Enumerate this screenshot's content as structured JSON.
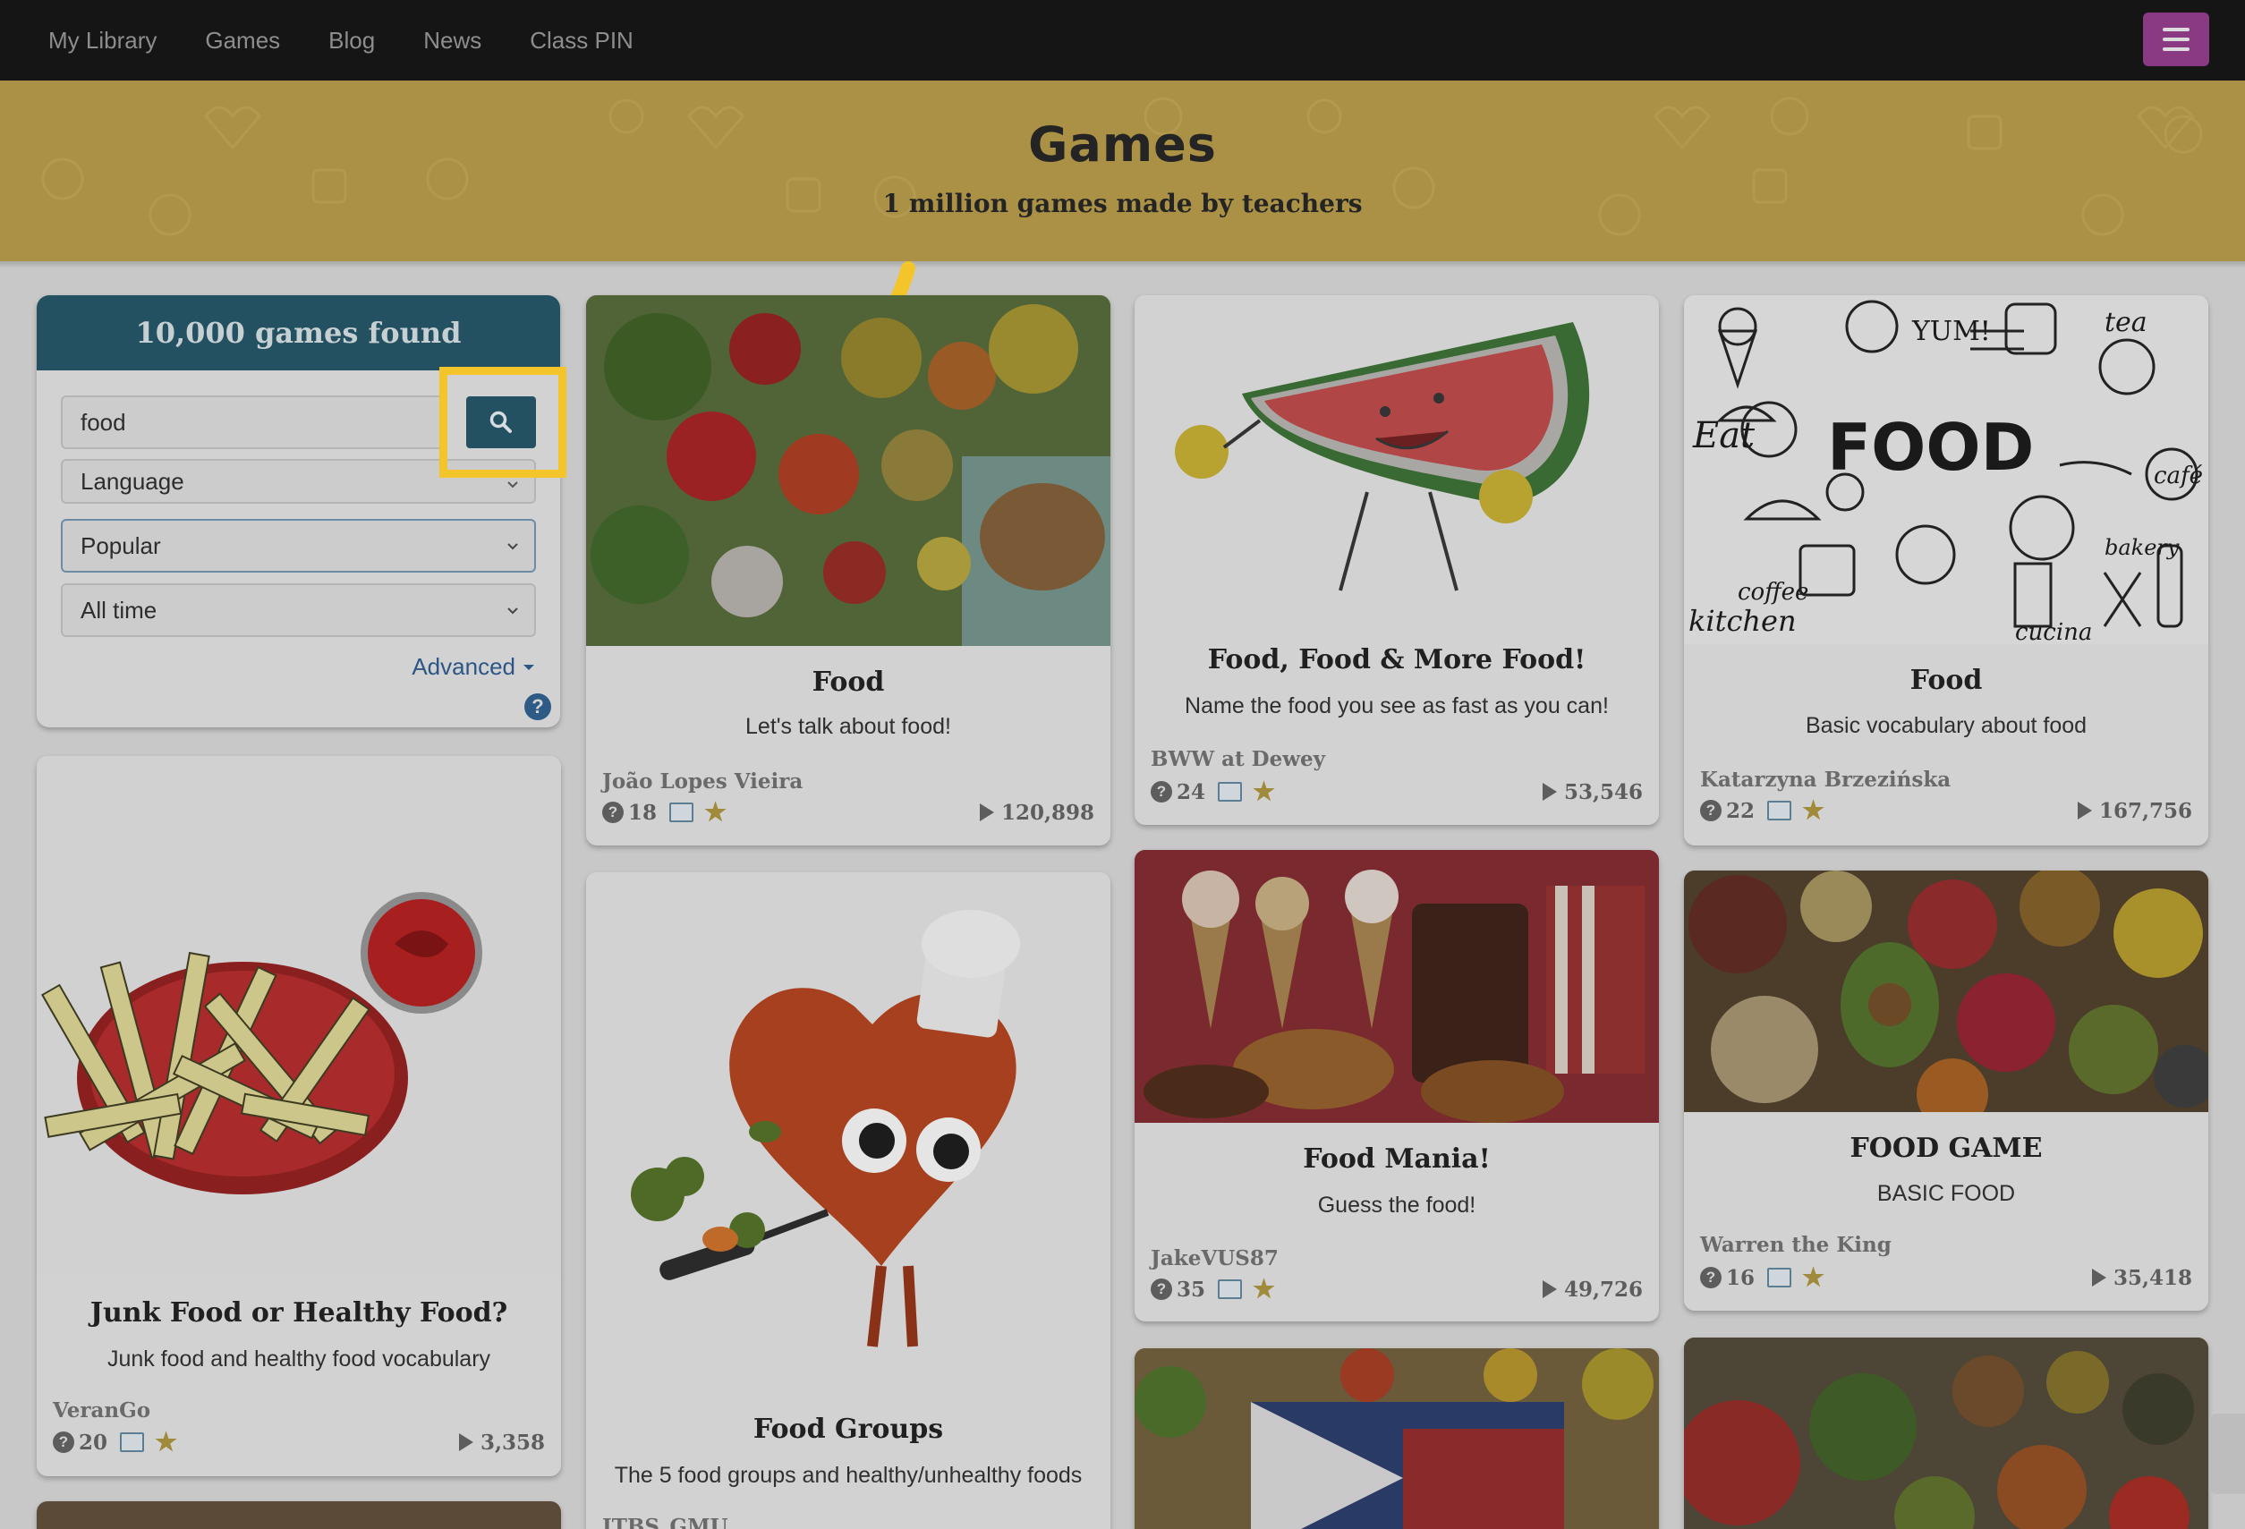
{
  "nav": {
    "links": [
      "My Library",
      "Games",
      "Blog",
      "News",
      "Class PIN"
    ]
  },
  "banner": {
    "title": "Games",
    "subtitle": "1 million games made by teachers"
  },
  "search": {
    "count_label": "10,000 games found",
    "query": "food",
    "language": "Language",
    "sort": "Popular",
    "period": "All time",
    "advanced": "Advanced",
    "help": "?"
  },
  "cards": [
    {
      "title": "Junk Food or Healthy Food?",
      "desc": "Junk food and healthy food vocabulary",
      "author": "VeranGo",
      "questions": "20",
      "plays": "3,358"
    },
    {
      "title": "Food",
      "desc": "Let's talk about food!",
      "author": "João Lopes Vieira",
      "questions": "18",
      "plays": "120,898"
    },
    {
      "title": "Food Groups",
      "desc": "The 5 food groups and healthy/unhealthy foods",
      "author": "ITBS_GMU",
      "questions": "",
      "plays": ""
    },
    {
      "title": "Food, Food & More Food!",
      "desc": "Name the food you see as fast as you can!",
      "author": "BWW at Dewey",
      "questions": "24",
      "plays": "53,546"
    },
    {
      "title": "Food Mania!",
      "desc": "Guess the food!",
      "author": "JakeVUS87",
      "questions": "35",
      "plays": "49,726"
    },
    {
      "title": "Food",
      "desc": "Basic vocabulary about food",
      "author": "Katarzyna Brzezińska",
      "questions": "22",
      "plays": "167,756"
    },
    {
      "title": "FOOD GAME",
      "desc": "BASIC FOOD",
      "author": "Warren the King",
      "questions": "16",
      "plays": "35,418"
    }
  ],
  "thumb_text": {
    "food_poster": "FOOD",
    "yum": "YUM!",
    "tea": "tea",
    "eat": "Eat",
    "cafe": "café",
    "bakery": "bakery",
    "coffee": "coffee",
    "kitchen": "kitchen",
    "cucina": "cucina"
  },
  "colors": {
    "nav_bg": "#151515",
    "banner_bg": "#aa9145",
    "search_header": "#245162",
    "highlight": "#f3c52b",
    "menu_btn": "#8a3a83"
  }
}
